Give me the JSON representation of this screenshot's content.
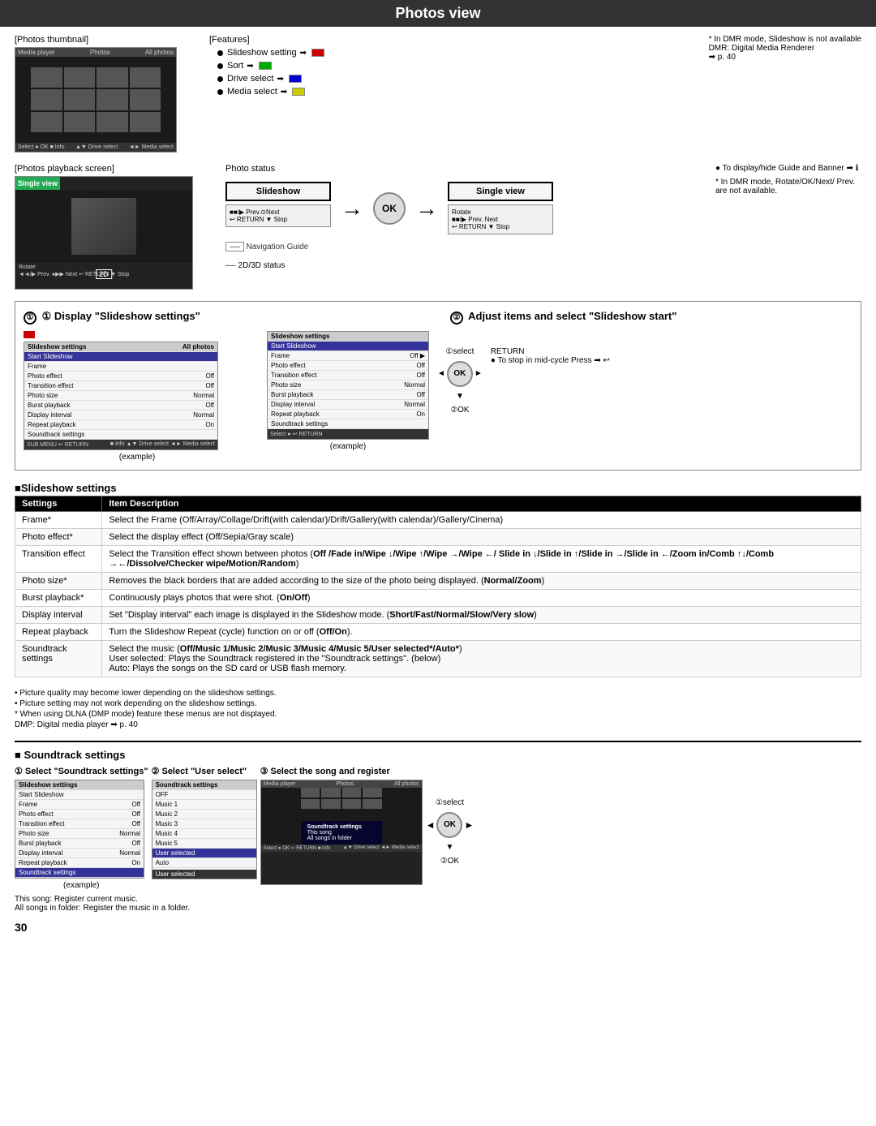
{
  "page": {
    "title": "Photos view",
    "page_number": "30"
  },
  "top_section": {
    "thumbnail_label": "[Photos thumbnail]",
    "features_label": "[Features]",
    "features": [
      {
        "id": "slideshow_setting",
        "label": "Slideshow setting",
        "button_color": "btn-r",
        "button_letter": "R"
      },
      {
        "id": "sort",
        "label": "Sort",
        "button_color": "btn-g",
        "button_letter": "G"
      },
      {
        "id": "drive_select",
        "label": "Drive select",
        "button_color": "btn-b",
        "button_letter": "B"
      },
      {
        "id": "media_select",
        "label": "Media select",
        "button_color": "btn-y",
        "button_letter": "Y"
      }
    ],
    "dmr_note": "* In DMR mode, Slideshow is not available",
    "dmr_full": "DMR: Digital Media Renderer",
    "dmr_ref": "➡ p. 40"
  },
  "playback_section": {
    "label": "[Photos playback screen]",
    "photo_status_label": "Photo status",
    "single_view_label": "Single view",
    "slideshow_label": "Slideshow",
    "single_view2_label": "Single view",
    "nav_guide_label": "Navigation Guide",
    "two_d_status_label": "2D/3D status",
    "info_note": "● To display/hide Guide and Banner ➡ ℹ",
    "dmr_note2": "* In DMR mode, Rotate/OK/Next/ Prev. are not available."
  },
  "display_section": {
    "title1": "① Display \"Slideshow settings\"",
    "title2": "② Adjust items and select \"Slideshow start\"",
    "example_label": "(example)",
    "select_label": "①select",
    "ok_label": "②OK",
    "return_note": "● To stop in mid-cycle Press ➡ ↩"
  },
  "slideshow_settings": {
    "section_label": "■Slideshow settings",
    "table_headers": [
      "Settings",
      "Item Description"
    ],
    "rows": [
      {
        "setting": "Frame*",
        "description": "Select the Frame (Off/Array/Collage/Drift(with calendar)/Drift/Gallery(with calendar)/Gallery/Cinema)"
      },
      {
        "setting": "Photo effect*",
        "description": "Select the display effect (Off/Sepia/Gray scale)"
      },
      {
        "setting": "Transition effect",
        "description": "Select the Transition effect shown between photos (Off /Fade in/Wipe ↓/Wipe ↑/Wipe →/Wipe ←/ Slide in ↓/Slide in ↑/Slide in →/Slide in ←/Zoom in/Comb ↑↓/Comb →←/Dissolve/Checker wipe/Motion/Random)"
      },
      {
        "setting": "Photo size*",
        "description": "Removes the black borders that are added according to the size of the photo being displayed. (Normal/Zoom)"
      },
      {
        "setting": "Burst playback*",
        "description": "Continuously plays photos that were shot. (On/Off)"
      },
      {
        "setting": "Display interval",
        "description": "Set \"Display interval\" each image is displayed in the Slideshow mode. (Short/Fast/Normal/Slow/Very slow)"
      },
      {
        "setting": "Repeat playback",
        "description": "Turn the Slideshow Repeat (cycle) function on or off (Off/On)."
      },
      {
        "setting": "Soundtrack settings",
        "description": "Select the music (Off/Music 1/Music 2/Music 3/Music 4/Music 5/User selected*/Auto*) User selected: Plays the Soundtrack registered in the \"Soundtrack settings\". (below) Auto: Plays the songs on the SD card or USB flash memory."
      }
    ]
  },
  "notes": [
    "• Picture quality may become lower depending on the slideshow settings.",
    "• Picture setting may not work depending on the slideshow settings.",
    "* When using DLNA (DMP mode) feature these menus are not displayed.",
    "DMP: Digital media player ➡ p. 40"
  ],
  "soundtrack_section": {
    "header": "■ Soundtrack settings",
    "step1_title": "① Select \"Soundtrack settings\"",
    "step2_title": "② Select \"User select\"",
    "step3_title": "③ Select the song and register",
    "step1_screen_title": "Slideshow settings",
    "step1_rows": [
      {
        "label": "Start Slideshow",
        "value": ""
      },
      {
        "label": "Frame",
        "value": "Off"
      },
      {
        "label": "Photo effect",
        "value": "Off"
      },
      {
        "label": "Transition effect",
        "value": "Off"
      },
      {
        "label": "Photo size",
        "value": "Normal"
      },
      {
        "label": "Burst playback",
        "value": "Off"
      },
      {
        "label": "Display interval",
        "value": "Normal"
      },
      {
        "label": "Repeat playback",
        "value": "On"
      },
      {
        "label": "Soundtrack settings",
        "value": "",
        "selected": true
      }
    ],
    "step2_screen_title": "Soundtrack settings",
    "step2_rows": [
      {
        "label": "OFF",
        "value": ""
      },
      {
        "label": "Music 1",
        "value": ""
      },
      {
        "label": "Music 2",
        "value": ""
      },
      {
        "label": "Music 3",
        "value": ""
      },
      {
        "label": "Music 4",
        "value": ""
      },
      {
        "label": "Music 5",
        "value": ""
      },
      {
        "label": "User selected",
        "value": "",
        "selected": true
      },
      {
        "label": "Auto",
        "value": ""
      }
    ],
    "step2_bottom": "User selected",
    "step3_this_song": "This song: Register current music.",
    "step3_all_songs": "All songs in folder: Register the music in a folder.",
    "select_label": "①select",
    "ok_label": "②OK"
  },
  "adjust_screen": {
    "title": "Slideshow settings",
    "rows": [
      {
        "label": "Start Slideshow",
        "value": "",
        "selected": false
      },
      {
        "label": "Frame",
        "value": "Off",
        "selected": false
      },
      {
        "label": "Photo effect",
        "value": "Off",
        "selected": false
      },
      {
        "label": "Transition effect",
        "value": "Off",
        "selected": false
      },
      {
        "label": "Photo size",
        "value": "Normal",
        "selected": false
      },
      {
        "label": "Burst playback",
        "value": "Off",
        "selected": false
      },
      {
        "label": "Display interval",
        "value": "Normal",
        "selected": false
      },
      {
        "label": "Repeat playback",
        "value": "On",
        "selected": false
      },
      {
        "label": "Soundtrack settings",
        "value": "",
        "selected": false
      }
    ]
  }
}
